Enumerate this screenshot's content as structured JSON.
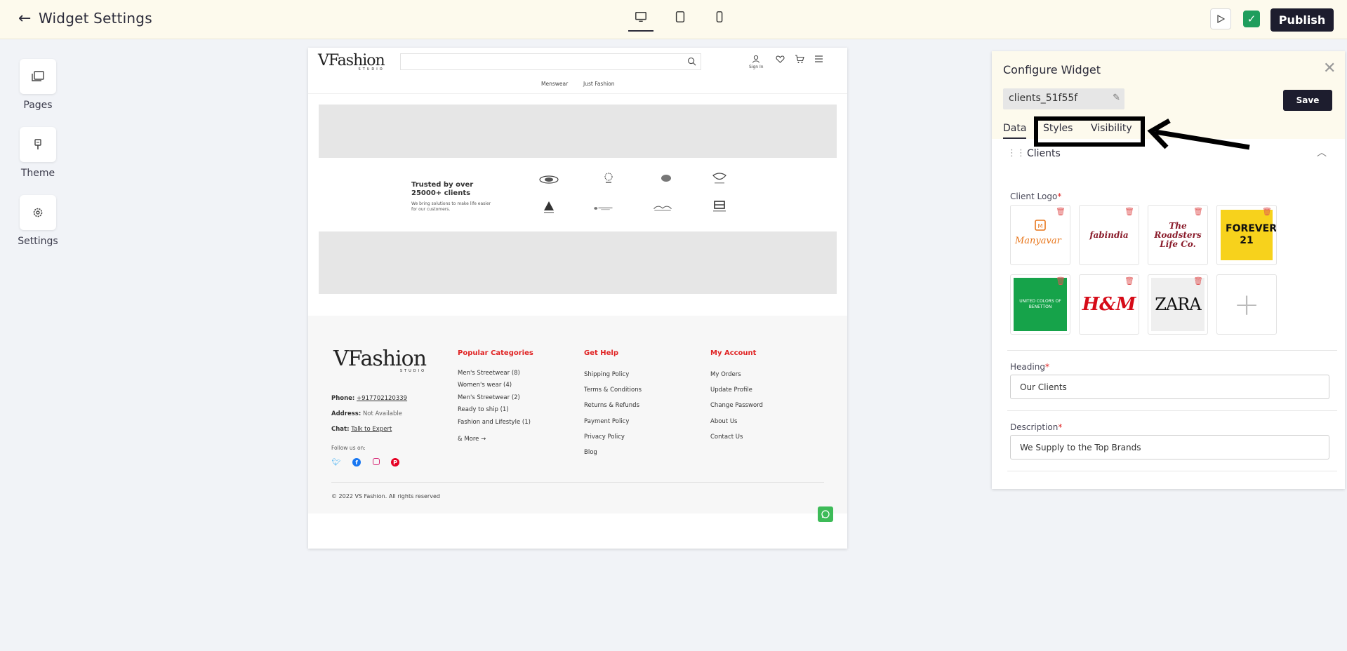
{
  "header": {
    "back_icon": "arrow-left-icon",
    "title": "Widget Settings",
    "devices": [
      "desktop-icon",
      "tablet-icon",
      "mobile-icon"
    ],
    "publish_label": "Publish"
  },
  "sidebar": {
    "items": [
      {
        "label": "Pages",
        "icon": "pages-icon"
      },
      {
        "label": "Theme",
        "icon": "brush-icon"
      },
      {
        "label": "Settings",
        "icon": "gear-icon"
      }
    ]
  },
  "site": {
    "logo": "VFashion",
    "logo_sub": "STUDIO",
    "sign_in": "Sign In",
    "nav": [
      "Menswear",
      "Just Fashion"
    ],
    "trusted_heading": "Trusted by over 25000+ clients",
    "trusted_text": "We bring solutions to make life easier for our customers.",
    "footer": {
      "phone_label": "Phone:",
      "phone": "+917702120339",
      "address_label": "Address:",
      "address": "Not Available",
      "chat_label": "Chat:",
      "chat": "Talk to Expert",
      "follow": "Follow us on:",
      "col1_title": "Popular Categories",
      "col1": [
        "Men's Streetwear (8)",
        "Women's wear (4)",
        "Men's Streetwear (2)",
        "Ready to ship (1)",
        "Fashion and Lifestyle (1)"
      ],
      "more": "& More →",
      "col2_title": "Get Help",
      "col2": [
        "Shipping Policy",
        "Terms & Conditions",
        "Returns & Refunds",
        "Payment Policy",
        "Privacy Policy",
        "Blog"
      ],
      "col3_title": "My Account",
      "col3": [
        "My Orders",
        "Update Profile",
        "Change Password",
        "About Us",
        "Contact Us"
      ],
      "copyright": "© 2022 VS Fashion. All rights reserved"
    }
  },
  "panel": {
    "title": "Configure Widget",
    "widget_id": "clients_51f55f",
    "save_label": "Save",
    "tabs": [
      "Data",
      "Styles",
      "Visibility"
    ],
    "section_title": "Clients",
    "client_logo_label": "Client Logo",
    "client_logos": [
      "Manyavar",
      "fabindia",
      "The Roadsters Life Co.",
      "FOREVER 21",
      "UNITED COLORS OF BENETTON",
      "H&M",
      "ZARA"
    ],
    "heading_label": "Heading",
    "heading_value": "Our Clients",
    "description_label": "Description",
    "description_value": "We Supply to the Top Brands"
  },
  "colors": {
    "topbar_bg": "#fdfaed",
    "dark": "#1d1d2e",
    "accent_red": "#e02424",
    "check_green": "#1f9d5c"
  }
}
